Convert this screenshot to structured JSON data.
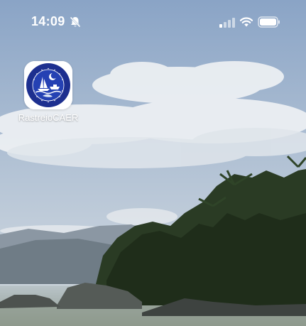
{
  "status_bar": {
    "time": "14:09",
    "silent_icon": "bell-slash-icon",
    "signal_icon": "cellular-signal-icon",
    "wifi_icon": "wifi-icon",
    "battery_icon": "battery-icon"
  },
  "home_screen": {
    "apps": [
      {
        "label": "RastreioCAER",
        "icon": "caer-app-icon"
      }
    ]
  },
  "colors": {
    "sky_top": "#8ea8c8",
    "sky_mid": "#b8c9da",
    "sea": "#a7b6bd",
    "icon_blue": "#1d2f8f"
  }
}
